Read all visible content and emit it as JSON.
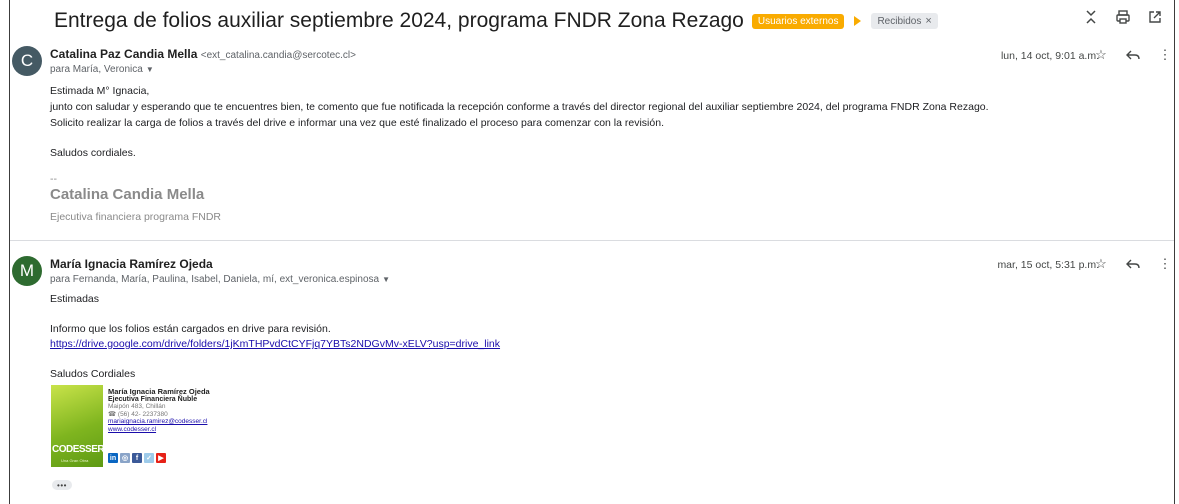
{
  "thread": {
    "subject": "Entrega de folios auxiliar septiembre 2024, programa FNDR Zona Rezago",
    "labels": {
      "external": "Usuarios externos",
      "inbox": "Recibidos",
      "inbox_remove": "×"
    },
    "toolbar": {
      "collapse_icon": "collapse-all-icon",
      "print_icon": "print-icon",
      "open_new_window_icon": "open-in-new-window-icon"
    }
  },
  "messages": [
    {
      "avatar_letter": "C",
      "avatar_color": "#455a64",
      "sender_name": "Catalina Paz Candia Mella",
      "sender_email": "<ext_catalina.candia@sercotec.cl>",
      "recipients": "para María, Veronica",
      "date": "lun, 14 oct, 9:01 a.m.",
      "body": [
        "Estimada M° Ignacia,",
        "junto con saludar y esperando que te encuentres bien, te comento que fue notificada la recepción conforme a través del director regional del auxiliar septiembre 2024, del programa FNDR Zona Rezago.",
        "Solicito realizar la carga de folios a través del drive e informar una vez que esté finalizado el proceso para comenzar con la revisión.",
        "Saludos cordiales."
      ],
      "signature": {
        "dashes": "--",
        "name": "Catalina Candia Mella",
        "role": "Ejecutiva financiera programa FNDR"
      }
    },
    {
      "avatar_letter": "M",
      "avatar_color": "#2e6b30",
      "sender_name": "María Ignacia Ramírez Ojeda",
      "recipients": "para Fernanda, María, Paulina, Isabel, Daniela, mí, ext_veronica.espinosa",
      "date": "mar, 15 oct, 5:31 p.m.",
      "body": [
        "Estimadas",
        "Informo que los folios están cargados en drive para revisión.",
        "https://drive.google.com/drive/folders/1jKmTHPvdCtCYFjq7YBTs2NDGvMv-xELV?usp=drive_link",
        "Saludos Cordiales"
      ],
      "card": {
        "name": "María Ignacia Ramírez Ojeda",
        "role": "Ejecutiva Financiera Ñuble",
        "address": "Maipón 483, Chillán",
        "phone": "☎ (56) 42- 2237380",
        "email": "mariaignacia.ramirez@codesser.cl",
        "web": "www.codesser.cl",
        "brand": "CODESSER",
        "brand_tag": "Una Gran Obra",
        "brand_color": "#7fb51f",
        "social": [
          "in",
          "◎",
          "f",
          "✓",
          "▶"
        ]
      }
    }
  ],
  "show_trimmed": "•••"
}
